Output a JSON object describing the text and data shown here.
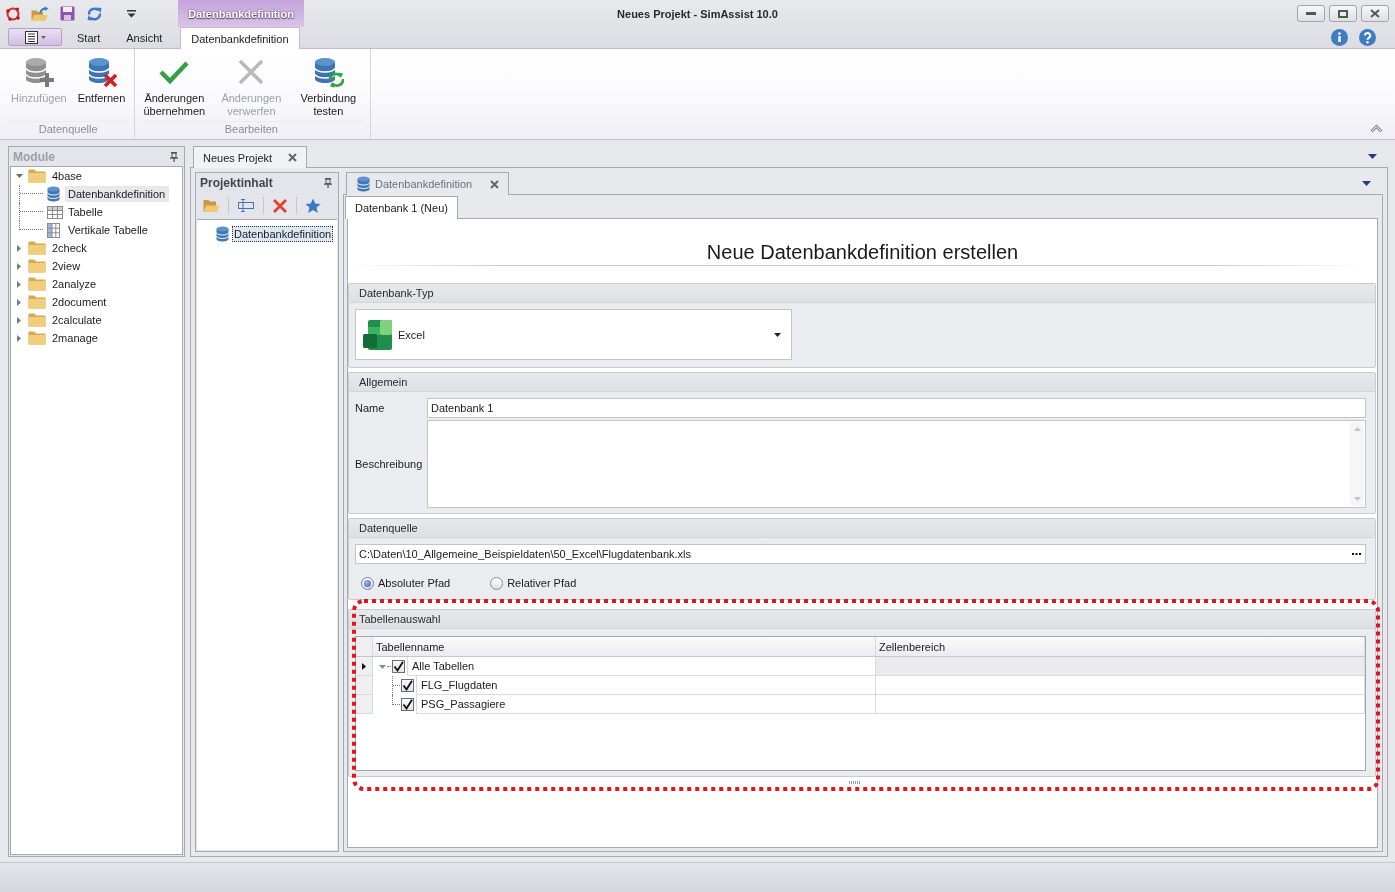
{
  "window": {
    "title": "Neues Projekt - SimAssist 10.0",
    "context_tab_group": "Datenbankdefinition"
  },
  "ribbon": {
    "tabs": [
      {
        "label": "Start",
        "selected": false
      },
      {
        "label": "Ansicht",
        "selected": false
      },
      {
        "label": "Datenbankdefinition",
        "selected": true
      }
    ],
    "groups": [
      {
        "label": "Datenquelle",
        "buttons": [
          {
            "label": "Hinzufügen",
            "kind": "add",
            "disabled": true
          },
          {
            "label": "Entfernen",
            "kind": "remove",
            "disabled": false
          }
        ]
      },
      {
        "label": "Bearbeiten",
        "buttons": [
          {
            "label": "Änderungen übernehmen",
            "kind": "apply",
            "disabled": false
          },
          {
            "label": "Änderungen verwerfen",
            "kind": "discard",
            "disabled": true
          },
          {
            "label": "Verbindung testen",
            "kind": "test",
            "disabled": false
          }
        ]
      }
    ]
  },
  "modules_panel": {
    "title": "Module",
    "items": [
      {
        "label": "4base",
        "kind": "folder",
        "expanded": true,
        "selected": false,
        "children": [
          {
            "label": "Datenbankdefinition",
            "kind": "database",
            "selected": true
          },
          {
            "label": "Tabelle",
            "kind": "table",
            "selected": false
          },
          {
            "label": "Vertikale Tabelle",
            "kind": "vertical-table",
            "selected": false
          }
        ]
      },
      {
        "label": "2check",
        "kind": "folder",
        "expanded": false,
        "selected": false
      },
      {
        "label": "2view",
        "kind": "folder",
        "expanded": false,
        "selected": false
      },
      {
        "label": "2analyze",
        "kind": "folder",
        "expanded": false,
        "selected": false
      },
      {
        "label": "2document",
        "kind": "folder",
        "expanded": false,
        "selected": false
      },
      {
        "label": "2calculate",
        "kind": "folder",
        "expanded": false,
        "selected": false
      },
      {
        "label": "2manage",
        "kind": "folder",
        "expanded": false,
        "selected": false
      }
    ]
  },
  "document_tabs": [
    {
      "label": "Neues Projekt",
      "selected": true
    }
  ],
  "project_panel": {
    "title": "Projektinhalt",
    "items": [
      {
        "label": "Datenbankdefinition",
        "selected": true
      }
    ]
  },
  "editor_tabs": [
    {
      "label": "Datenbankdefinition",
      "selected": true
    }
  ],
  "page_tabs": [
    {
      "label": "Datenbank 1 (Neu)",
      "selected": true
    }
  ],
  "form": {
    "heading": "Neue Datenbankdefinition erstellen",
    "database_type": {
      "title": "Datenbank-Typ",
      "value": "Excel"
    },
    "general": {
      "title": "Allgemein",
      "name_label": "Name",
      "name_value": "Datenbank 1",
      "description_label": "Beschreibung"
    },
    "data_source": {
      "title": "Datenquelle",
      "path": "C:\\Daten\\10_Allgemeine_Beispieldaten\\50_Excel\\Flugdatenbank.xls",
      "path_modes": [
        {
          "label": "Absoluter Pfad",
          "selected": true
        },
        {
          "label": "Relativer Pfad",
          "selected": false
        }
      ]
    },
    "table_selection": {
      "title": "Tabellenauswahl",
      "highlighted": true,
      "columns": [
        "Tabellenname",
        "Zellenbereich"
      ],
      "rows": [
        {
          "label": "Alle Tabellen",
          "checked": true,
          "expanded": true,
          "selected": true,
          "children": [
            {
              "label": "FLG_Flugdaten",
              "checked": true,
              "selected": false
            },
            {
              "label": "PSG_Passagiere",
              "checked": true,
              "selected": false
            }
          ]
        }
      ]
    }
  }
}
